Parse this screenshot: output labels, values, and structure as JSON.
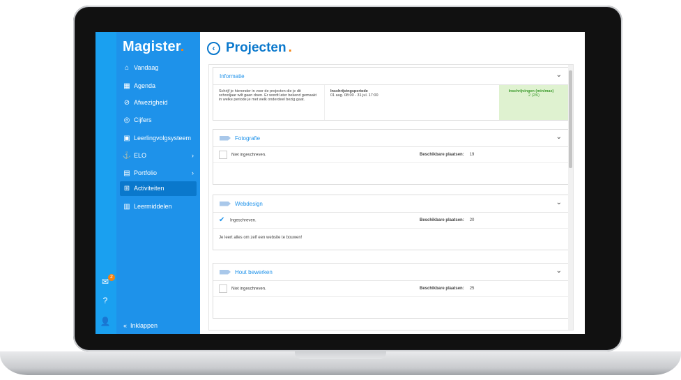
{
  "app": {
    "logo": "Magister",
    "logo_dot": "."
  },
  "rail": {
    "badge_count": "2"
  },
  "sidebar": {
    "items": [
      {
        "label": "Vandaag",
        "icon": "home-icon"
      },
      {
        "label": "Agenda",
        "icon": "calendar-icon"
      },
      {
        "label": "Afwezigheid",
        "icon": "check-circle-icon"
      },
      {
        "label": "Cijfers",
        "icon": "grade-icon"
      },
      {
        "label": "Leerlingvolgsysteem",
        "icon": "student-tracking-icon"
      },
      {
        "label": "ELO",
        "icon": "elo-icon"
      },
      {
        "label": "Portfolio",
        "icon": "portfolio-icon"
      },
      {
        "label": "Activiteiten",
        "icon": "activities-icon"
      },
      {
        "label": "Leermiddelen",
        "icon": "learning-materials-icon"
      }
    ],
    "collapse_label": "Inklappen"
  },
  "main": {
    "title": "Projecten",
    "title_dot": ".",
    "info": {
      "header": "Informatie",
      "intro": "Schrijf je hieronder in voor de projecten die je dit schooljaar wilt gaan doen. Er wordt later bekend gemaakt in welke periode je met welk onderdeel bezig gaat.",
      "period_label": "Inschrijvingsperiode",
      "period_value": "01 aug. 08:00 - 31 jul. 17:00",
      "registrations_label": "Inschrijvingen (min/max)",
      "registrations_value": "2 (2/6)"
    },
    "projects": [
      {
        "name": "Fotografie",
        "status": "Niet ingeschreven.",
        "places_label": "Beschikbare plaatsen:",
        "places": "19",
        "description": ""
      },
      {
        "name": "Webdesign",
        "status": "Ingeschreven.",
        "places_label": "Beschikbare plaatsen:",
        "places": "20",
        "description": "Je leert alles om zelf een website te bouwen!"
      },
      {
        "name": "Hout bewerken",
        "status": "Niet ingeschreven.",
        "places_label": "Beschikbare plaatsen:",
        "places": "25",
        "description": ""
      }
    ]
  },
  "colors": {
    "accent": "#1e92ea",
    "brand_orange": "#f5820f",
    "success_bg": "#dff2d0"
  }
}
